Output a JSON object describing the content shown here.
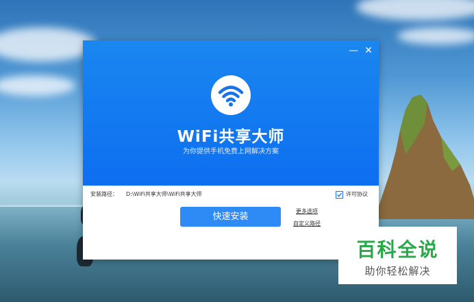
{
  "installer": {
    "app_title": "WiFi共享大师",
    "subtitle": "为你提供手机免费上网解决方案",
    "minimize_glyph": "—",
    "close_glyph": "✕",
    "install_path_label": "安装路径：",
    "install_path_value": "D:\\WiFi共享大师\\WiFi共享大师",
    "license_checked": true,
    "license_label": "许可协议",
    "install_button": "快速安装",
    "more_options_link": "更多选项",
    "custom_path_link": "自定义路径"
  },
  "watermark": {
    "title": "百科全说",
    "subtitle": "助你轻松解决"
  },
  "icons": [
    "wifi-icon",
    "checkmark-icon",
    "minimize-icon",
    "close-icon"
  ],
  "colors": {
    "header_blue": "#0d6ef0",
    "button_blue": "#2e8af5",
    "watermark_green": "#2aa84a"
  }
}
